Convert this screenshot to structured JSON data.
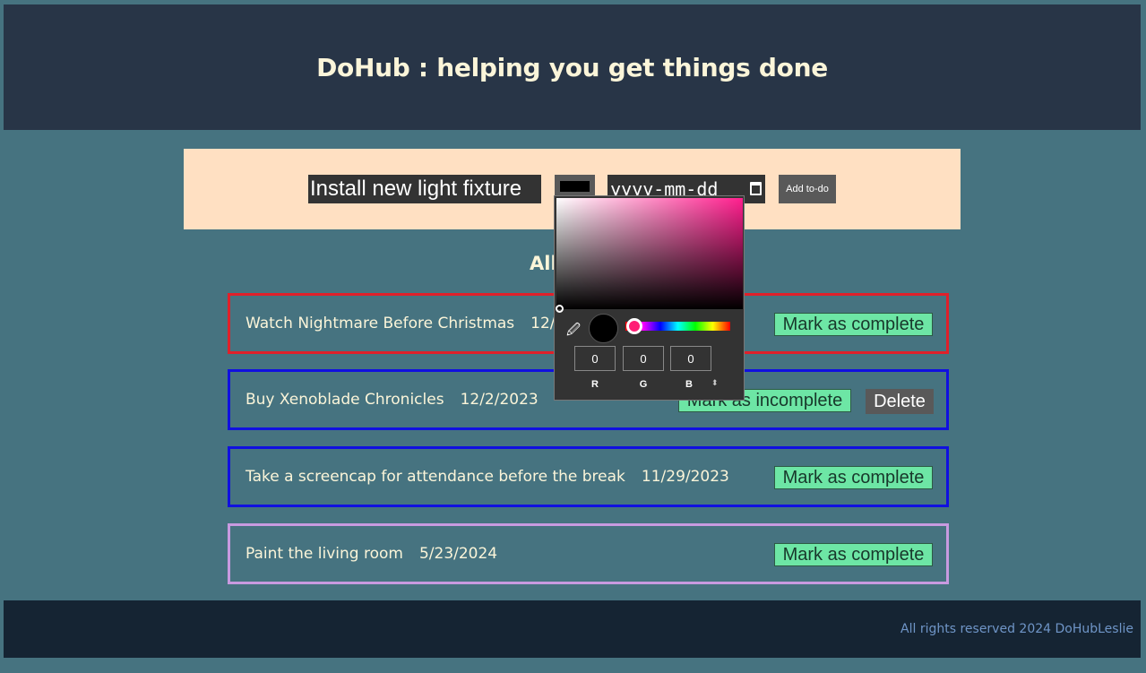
{
  "header": {
    "title": "DoHub : helping you get things done"
  },
  "form": {
    "text_value": "Install new light fixture",
    "color_value": "#000000",
    "date_placeholder": "yyyy-mm-dd",
    "add_button": "Add to-do"
  },
  "list": {
    "heading": "All",
    "items": [
      {
        "text": "Watch Nightmare Before Christmas",
        "date": "12/1/",
        "border_color": "#e0202a",
        "buttons": [
          "Mark as complete"
        ]
      },
      {
        "text": "Buy Xenoblade Chronicles",
        "date": "12/2/2023",
        "border_color": "#1010e0",
        "buttons": [
          "Mark as incomplete",
          "Delete"
        ]
      },
      {
        "text": "Take a screencap for attendance before the break",
        "date": "11/29/2023",
        "border_color": "#1010e0",
        "buttons": [
          "Mark as complete"
        ]
      },
      {
        "text": "Paint the living room",
        "date": "5/23/2024",
        "border_color": "#c89ae0",
        "buttons": [
          "Mark as complete"
        ]
      }
    ]
  },
  "color_picker": {
    "r": "0",
    "g": "0",
    "b": "0",
    "labels": {
      "r": "R",
      "g": "G",
      "b": "B"
    },
    "hue_color": "#ff1f8e"
  },
  "footer": {
    "text": "All rights reserved 2024 DoHubLeslie"
  }
}
